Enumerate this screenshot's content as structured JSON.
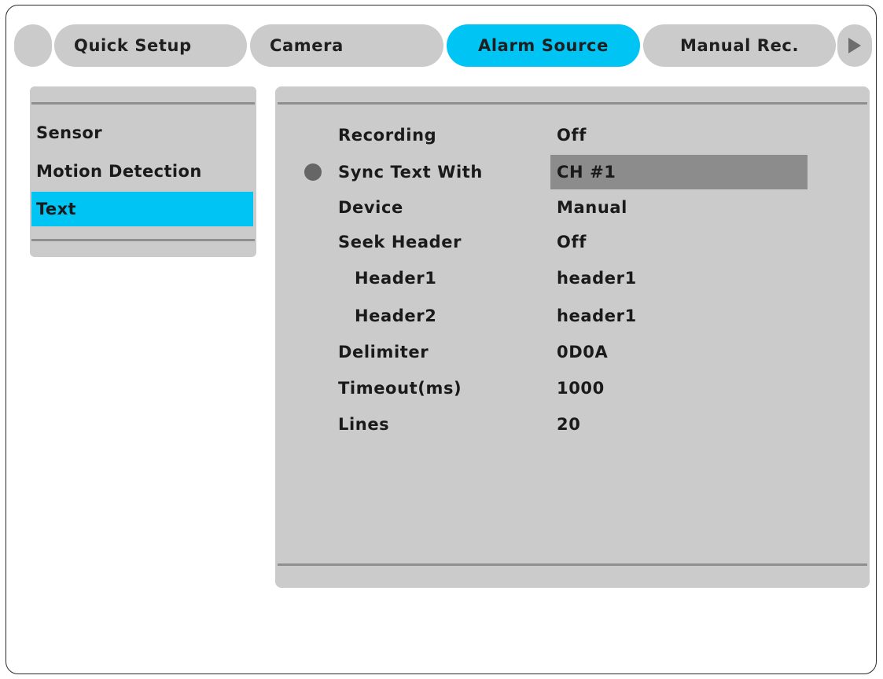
{
  "tabs": [
    {
      "label": "",
      "active": false
    },
    {
      "label": "Quick Setup",
      "active": false
    },
    {
      "label": "Camera",
      "active": false
    },
    {
      "label": "Alarm Source",
      "active": true
    },
    {
      "label": "Manual Rec.",
      "active": false
    }
  ],
  "tab_next_icon": "play-right-arrow-icon",
  "sidebar": {
    "items": [
      {
        "label": "Sensor",
        "active": false
      },
      {
        "label": "Motion Detection",
        "active": false
      },
      {
        "label": "Text",
        "active": true
      }
    ]
  },
  "settings": {
    "rows": [
      {
        "label": "Recording",
        "value": "Off"
      },
      {
        "label": "Sync Text With",
        "value": "CH #1",
        "selected": true
      },
      {
        "label": "Device",
        "value": "Manual"
      },
      {
        "label": "Seek Header",
        "value": "Off"
      },
      {
        "label": "Header1",
        "value": "header1",
        "indent": true
      },
      {
        "label": "Header2",
        "value": "header1",
        "indent": true
      },
      {
        "label": "Delimiter",
        "value": "0D0A"
      },
      {
        "label": "Timeout(ms)",
        "value": "1000"
      },
      {
        "label": "Lines",
        "value": "20"
      }
    ]
  },
  "colors": {
    "accent": "#00c4f4",
    "panel": "#cbcbcb",
    "selected_value_bg": "#8c8c8c",
    "bullet": "#666666"
  }
}
